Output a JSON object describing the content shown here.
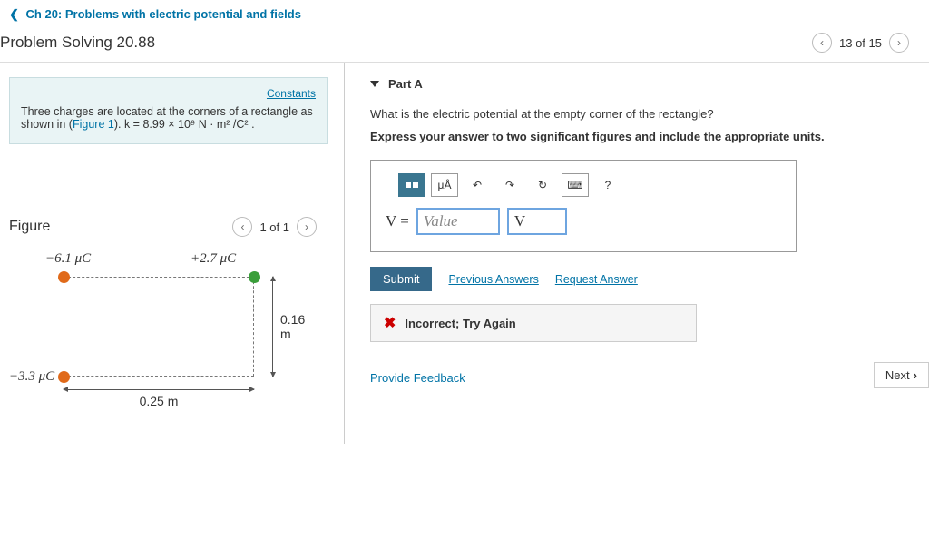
{
  "header": {
    "chapter_link": "Ch 20: Problems with electric potential and fields",
    "title": "Problem Solving 20.88",
    "pager": "13 of 15"
  },
  "intro": {
    "constants_link": "Constants",
    "text_before": "Three charges are located at the corners of a rectangle as shown in (",
    "figure_ref": "Figure 1",
    "text_after": "). k = 8.99 × 10⁹ N · m² /C² ."
  },
  "figure": {
    "heading": "Figure",
    "pager": "1 of 1",
    "charge_tl": "−6.1 μC",
    "charge_tr": "+2.7 μC",
    "charge_bl": "−3.3 μC",
    "height_dim": "0.16 m",
    "width_dim": "0.25 m"
  },
  "part": {
    "label": "Part A",
    "question": "What is the electric potential at the empty corner of the rectangle?",
    "instruction": "Express your answer to two significant figures and include the appropriate units.",
    "toolbar": {
      "units_btn": "μÅ",
      "undo": "↶",
      "redo": "↷",
      "reset": "↻",
      "keyboard": "⌨",
      "help": "?"
    },
    "variable": "V =",
    "value_placeholder": "Value",
    "units_placeholder": "V",
    "submit": "Submit",
    "prev_answers": "Previous Answers",
    "request_answer": "Request Answer",
    "incorrect_msg": "Incorrect; Try Again"
  },
  "footer": {
    "feedback": "Provide Feedback",
    "next": "Next"
  }
}
